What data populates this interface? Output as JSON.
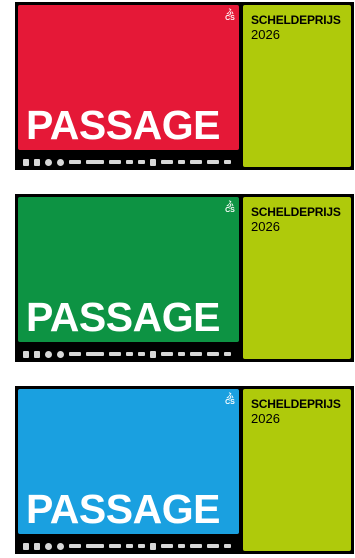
{
  "passes": [
    {
      "label": "PASSAGE",
      "event": "SCHELDEPRIJS",
      "year": "2026",
      "color": "#e51837"
    },
    {
      "label": "PASSAGE",
      "event": "SCHELDEPRIJS",
      "year": "2026",
      "color": "#0d9343"
    },
    {
      "label": "PASSAGE",
      "event": "SCHELDEPRIJS",
      "year": "2026",
      "color": "#1aa0e0"
    }
  ],
  "brand": {
    "logo_top": "ふ",
    "logo_bottom": "CS",
    "side_color": "#afca0b"
  },
  "sponsor_icons": [
    "sponsor-logo-icon"
  ]
}
